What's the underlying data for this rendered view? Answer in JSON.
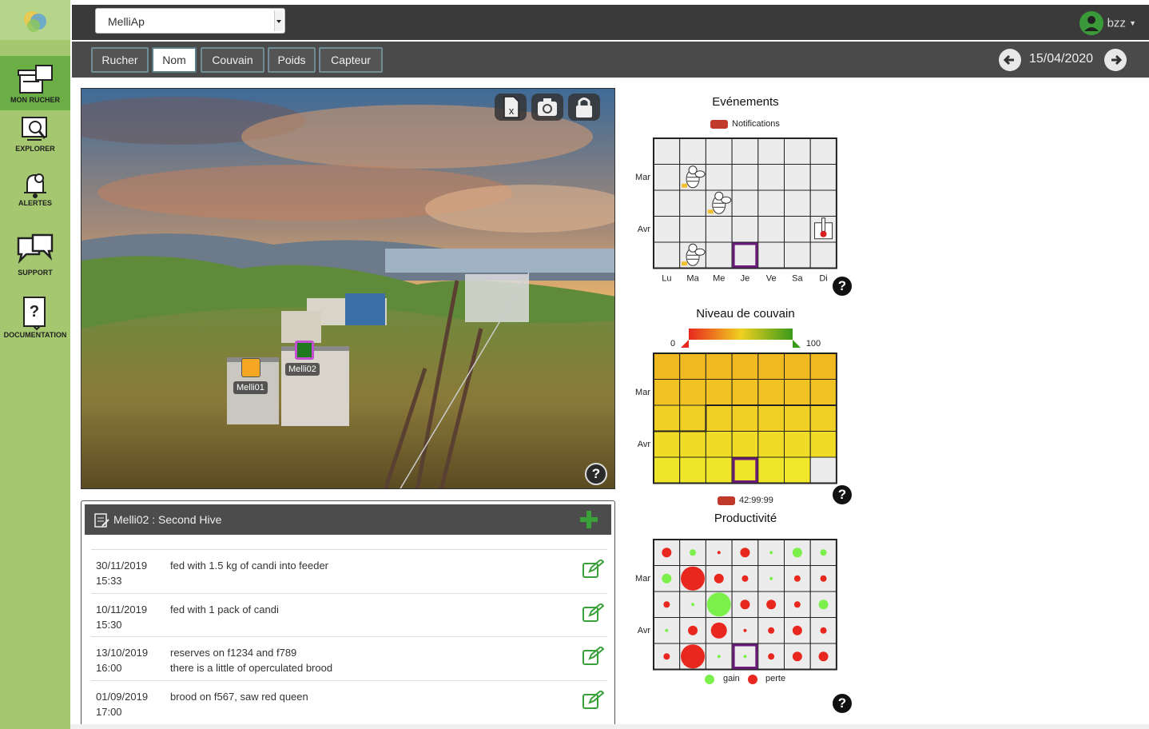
{
  "nav": [
    {
      "label": "MON RUCHER",
      "icon": "hive-icon",
      "active": true
    },
    {
      "label": "EXPLORER",
      "icon": "explore-icon",
      "active": false
    },
    {
      "label": "ALERTES",
      "icon": "alert-bell-icon",
      "active": false
    },
    {
      "label": "SUPPORT",
      "icon": "chat-icon",
      "active": false
    },
    {
      "label": "DOCUMENTATION",
      "icon": "documentation-icon",
      "active": false
    }
  ],
  "header": {
    "apiary_select": "MelliAp",
    "user": "bzz"
  },
  "tabs": [
    "Rucher",
    "Nom",
    "Couvain",
    "Poids",
    "Capteur"
  ],
  "active_tab": "Nom",
  "date": "15/04/2020",
  "photo": {
    "tools": [
      "excel-export-icon",
      "camera-icon",
      "lock-icon"
    ],
    "markers": [
      {
        "label": "Melli01",
        "color": "#f5a623",
        "selected": false
      },
      {
        "label": "Melli02",
        "color": "#1f7a1f",
        "selected": true
      }
    ]
  },
  "log": {
    "title": "Melli02 : Second Hive",
    "entries": [
      {
        "date": "30/11/2019",
        "time": "15:33",
        "lines": [
          "fed with 1.5 kg of candi into feeder"
        ]
      },
      {
        "date": "10/11/2019",
        "time": "15:30",
        "lines": [
          "fed with 1 pack of candi"
        ]
      },
      {
        "date": "13/10/2019",
        "time": "16:00",
        "lines": [
          "reserves on f1234 and f789",
          "there is a little of operculated brood"
        ]
      },
      {
        "date": "01/09/2019",
        "time": "17:00",
        "lines": [
          "brood on f567, saw red queen"
        ]
      }
    ]
  },
  "chart_data": [
    {
      "type": "heatmap",
      "title": "Evénements",
      "legend": [
        "Notifications"
      ],
      "columns": [
        "Lu",
        "Ma",
        "Me",
        "Je",
        "Ve",
        "Sa",
        "Di"
      ],
      "row_labels": [
        "",
        "Mar",
        "",
        "Avr",
        ""
      ],
      "events": [
        {
          "row": 1,
          "col": 1,
          "icon": "bee-icon"
        },
        {
          "row": 2,
          "col": 2,
          "icon": "bee-icon"
        },
        {
          "row": 3,
          "col": 6,
          "icon": "thermometer-icon"
        },
        {
          "row": 4,
          "col": 1,
          "icon": "bee-icon"
        }
      ],
      "selected": {
        "row": 4,
        "col": 3
      }
    },
    {
      "type": "heatmap",
      "title": "Niveau de couvain",
      "scale": {
        "min": 0,
        "max": 100
      },
      "columns": [
        "",
        "",
        "",
        "",
        "",
        "",
        ""
      ],
      "row_labels": [
        "",
        "Mar",
        "",
        "Avr",
        ""
      ],
      "values": [
        [
          30,
          30,
          30,
          30,
          30,
          30,
          30
        ],
        [
          34,
          34,
          34,
          34,
          34,
          34,
          34
        ],
        [
          40,
          40,
          40,
          40,
          40,
          40,
          40
        ],
        [
          45,
          45,
          45,
          45,
          45,
          45,
          45
        ],
        [
          52,
          52,
          52,
          52,
          52,
          55,
          null
        ]
      ],
      "selected": {
        "row": 4,
        "col": 3
      },
      "legend": [
        "42:99:99"
      ]
    },
    {
      "type": "scatter",
      "title": "Productivité",
      "legend": [
        "gain",
        "perte"
      ],
      "columns": [
        "",
        "",
        "",
        "",
        "",
        "",
        ""
      ],
      "row_labels": [
        "",
        "Mar",
        "",
        "Avr",
        ""
      ],
      "cells": [
        [
          {
            "s": 3,
            "g": false
          },
          {
            "s": 2,
            "g": true
          },
          {
            "s": 1,
            "g": false
          },
          {
            "s": 3,
            "g": false
          },
          {
            "s": 1,
            "g": true
          },
          {
            "s": 3,
            "g": true
          },
          {
            "s": 2,
            "g": true
          }
        ],
        [
          {
            "s": 3,
            "g": true
          },
          {
            "s": 5,
            "g": false
          },
          {
            "s": 3,
            "g": false
          },
          {
            "s": 2,
            "g": false
          },
          {
            "s": 1,
            "g": true
          },
          {
            "s": 2,
            "g": false
          },
          {
            "s": 2,
            "g": false
          }
        ],
        [
          {
            "s": 2,
            "g": false
          },
          {
            "s": 1,
            "g": true
          },
          {
            "s": 5,
            "g": true
          },
          {
            "s": 3,
            "g": false
          },
          {
            "s": 3,
            "g": false
          },
          {
            "s": 2,
            "g": false
          },
          {
            "s": 3,
            "g": true
          }
        ],
        [
          {
            "s": 1,
            "g": true
          },
          {
            "s": 3,
            "g": false
          },
          {
            "s": 4,
            "g": false
          },
          {
            "s": 1,
            "g": false
          },
          {
            "s": 2,
            "g": false
          },
          {
            "s": 3,
            "g": false
          },
          {
            "s": 2,
            "g": false
          }
        ],
        [
          {
            "s": 2,
            "g": false
          },
          {
            "s": 5,
            "g": false
          },
          {
            "s": 1,
            "g": true
          },
          {
            "s": 1,
            "g": true
          },
          {
            "s": 2,
            "g": false
          },
          {
            "s": 3,
            "g": false
          },
          {
            "s": 3,
            "g": false
          }
        ]
      ],
      "selected": {
        "row": 4,
        "col": 3
      }
    }
  ],
  "colors": {
    "accent": "#6aae45",
    "sidebar": "#a4c76f",
    "selection": "#6a1b7a",
    "loss": "#e8281e",
    "gain": "#7cf04a"
  }
}
